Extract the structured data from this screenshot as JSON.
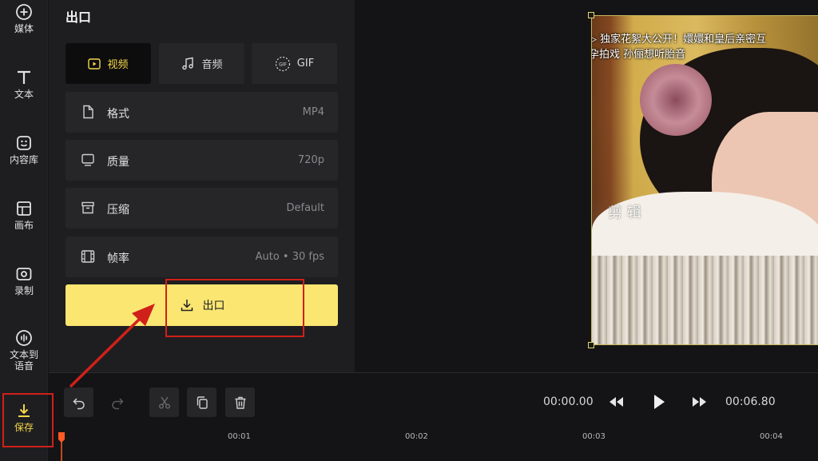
{
  "rail": {
    "items": [
      {
        "label": "媒体",
        "icon": "plus-circle-icon"
      },
      {
        "label": "文本",
        "icon": "text-icon"
      },
      {
        "label": "内容库",
        "icon": "sticker-icon"
      },
      {
        "label": "画布",
        "icon": "canvas-icon"
      },
      {
        "label": "录制",
        "icon": "record-icon"
      },
      {
        "label": "文本到\n语音",
        "label_line1": "文本到",
        "label_line2": "语音",
        "icon": "tts-icon"
      },
      {
        "label": "保存",
        "icon": "download-icon",
        "active": true
      }
    ]
  },
  "panel": {
    "title": "出口",
    "tabs": [
      {
        "label": "视频",
        "icon": "video-icon",
        "active": true
      },
      {
        "label": "音频",
        "icon": "music-note-icon"
      },
      {
        "label": "GIF",
        "icon": "gif-icon"
      }
    ],
    "settings": [
      {
        "label": "格式",
        "value": "MP4",
        "icon": "file-icon"
      },
      {
        "label": "质量",
        "value": "720p",
        "icon": "monitor-icon"
      },
      {
        "label": "压缩",
        "value": "Default",
        "icon": "archive-icon"
      },
      {
        "label": "帧率",
        "value": "Auto • 30 fps",
        "icon": "film-icon"
      }
    ],
    "export_button": "出口"
  },
  "preview": {
    "caption_line1": "▷ 独家花絮大公开！嬛嬛和皇后亲密互",
    "caption_line2": "孕拍戏 孙俪想听胎音",
    "watermark": "剪 辑"
  },
  "toolbar": {
    "current_time": "00:00.00",
    "total_time": "00:06.80"
  },
  "ruler": {
    "ticks": [
      "00:01",
      "00:02",
      "00:03",
      "00:04"
    ]
  },
  "colors": {
    "accent": "#fbe672",
    "active_text": "#f5d64b",
    "annotation": "#d0201a",
    "playhead": "#ff5a24"
  }
}
